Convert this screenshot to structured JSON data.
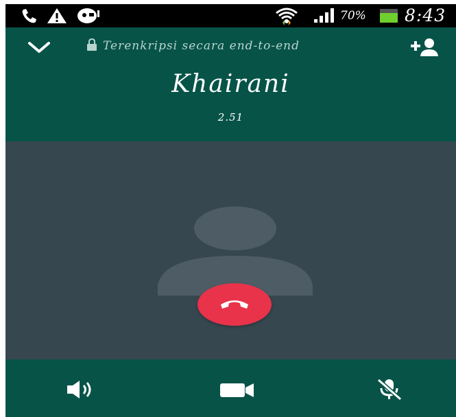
{
  "status_bar": {
    "battery_percent": "70%",
    "time": "8:43",
    "icons": [
      "phone-call-icon",
      "warning-icon",
      "voicemail-icon",
      "wifi-icon",
      "signal-icon",
      "battery-icon"
    ]
  },
  "header": {
    "encryption_text": "Terenkripsi secara end-to-end",
    "caller_name": "Khairani",
    "call_timer": "2.51",
    "icons": [
      "chevron-down-icon",
      "lock-icon",
      "add-participant-icon"
    ]
  },
  "avatar": {
    "icon": "default-avatar-icon"
  },
  "end_call": {
    "icon": "end-call-icon",
    "color": "#e8334a"
  },
  "controls": [
    {
      "icon": "speaker-icon"
    },
    {
      "icon": "video-camera-icon"
    },
    {
      "icon": "mute-microphone-icon"
    }
  ],
  "colors": {
    "header_bg": "#075348",
    "avatar_bg": "#37474f",
    "status_bar_bg": "#000000"
  }
}
